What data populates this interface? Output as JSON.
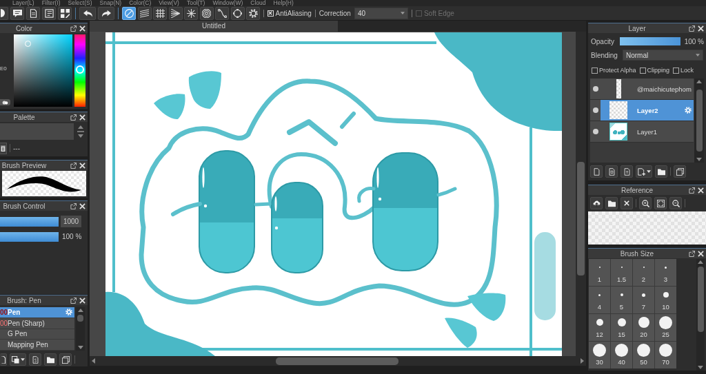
{
  "menu_bar": [
    "Layer(L)",
    "Filter(I)",
    "Select(S)",
    "Snap(N)",
    "Color(C)",
    "View(V)",
    "Tool(T)",
    "Window(W)",
    "Cloud",
    "Help(H)"
  ],
  "toolbar": {
    "snap_modes": [
      {
        "kind": "off",
        "selected": true
      },
      {
        "kind": "parallel",
        "selected": false
      },
      {
        "kind": "grid",
        "selected": false
      },
      {
        "kind": "perspective",
        "selected": false
      },
      {
        "kind": "radial",
        "selected": false
      },
      {
        "kind": "concentric",
        "selected": false
      },
      {
        "kind": "curve",
        "selected": false
      },
      {
        "kind": "ellipse",
        "selected": false
      },
      {
        "kind": "settings",
        "selected": false
      }
    ],
    "antialiasing": {
      "label": "AntiAliasing",
      "checked": true
    },
    "correction": {
      "label": "Correction",
      "value": "40"
    },
    "soft_edge": {
      "label": "Soft Edge",
      "checked": false,
      "disabled": true
    }
  },
  "color_panel": {
    "title": "Color",
    "hex_fragment": "E0",
    "hue_slider": {
      "level": 0.49
    }
  },
  "palette_panel": {
    "title": "Palette",
    "entry": "---"
  },
  "brush_preview_panel": {
    "title": "Brush Preview"
  },
  "brush_control_panel": {
    "title": "Brush Control",
    "sliders": [
      {
        "kind": "input",
        "level": 1,
        "reading": "1000"
      },
      {
        "kind": "label",
        "level": 1,
        "reading": "100 %"
      }
    ]
  },
  "brush_panel": {
    "title": "Brush: Pen",
    "brushes": [
      {
        "size": "00",
        "name": "Pen",
        "selected": true
      },
      {
        "size": "00",
        "name": "Pen (Sharp)",
        "selected": false
      },
      {
        "name": "G Pen",
        "selected": false
      },
      {
        "name": "Mapping Pen",
        "selected": false
      }
    ]
  },
  "document": {
    "tab": "Untitled"
  },
  "layer_panel": {
    "title": "Layer",
    "opacity": {
      "label": "Opacity",
      "level": 1,
      "reading": "100 %"
    },
    "blending": {
      "label": "Blending",
      "value": "Normal"
    },
    "options": [
      {
        "label": "Protect Alpha",
        "checked": false
      },
      {
        "label": "Clipping",
        "checked": false
      },
      {
        "label": "Lock",
        "checked": false
      }
    ],
    "layers": [
      {
        "name": "@maichicutephom",
        "kind": "strip",
        "visible": true,
        "selected": false
      },
      {
        "name": "Layer2",
        "kind": "blank",
        "visible": true,
        "selected": true
      },
      {
        "name": "Layer1",
        "kind": "artwork",
        "visible": true,
        "selected": false
      }
    ]
  },
  "reference_panel": {
    "title": "Reference"
  },
  "brush_size_panel": {
    "title": "Brush Size",
    "sizes": [
      "1",
      "1.5",
      "2",
      "3",
      "4",
      "5",
      "7",
      "10",
      "12",
      "15",
      "20",
      "25",
      "30",
      "40",
      "50",
      "70"
    ]
  }
}
